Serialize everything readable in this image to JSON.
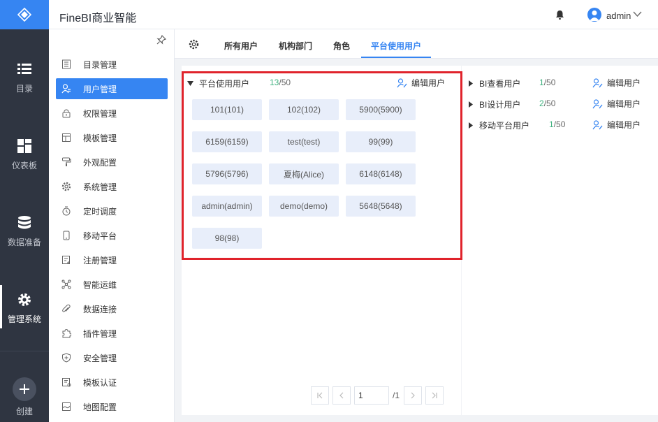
{
  "app": {
    "title": "FineBI商业智能",
    "user": "admin"
  },
  "rail": {
    "items": [
      {
        "label": "目录",
        "icon": "list-icon"
      },
      {
        "label": "仪表板",
        "icon": "dashboard-icon"
      },
      {
        "label": "数据准备",
        "icon": "database-icon"
      },
      {
        "label": "管理系统",
        "icon": "gear-icon"
      }
    ],
    "create_label": "创建"
  },
  "sidebar": {
    "items": [
      {
        "label": "目录管理",
        "icon": "catalog-icon"
      },
      {
        "label": "用户管理",
        "icon": "user-icon"
      },
      {
        "label": "权限管理",
        "icon": "lock-icon"
      },
      {
        "label": "模板管理",
        "icon": "template-icon"
      },
      {
        "label": "外观配置",
        "icon": "paint-roller-icon"
      },
      {
        "label": "系统管理",
        "icon": "settings-icon"
      },
      {
        "label": "定时调度",
        "icon": "timer-icon"
      },
      {
        "label": "移动平台",
        "icon": "mobile-icon"
      },
      {
        "label": "注册管理",
        "icon": "register-icon"
      },
      {
        "label": "智能运维",
        "icon": "network-icon"
      },
      {
        "label": "数据连接",
        "icon": "paperclip-icon"
      },
      {
        "label": "插件管理",
        "icon": "puzzle-icon"
      },
      {
        "label": "安全管理",
        "icon": "shield-icon"
      },
      {
        "label": "模板认证",
        "icon": "certificate-icon"
      },
      {
        "label": "地图配置",
        "icon": "map-icon"
      }
    ],
    "active_index": 1
  },
  "tabs": [
    {
      "label": "所有用户"
    },
    {
      "label": "机构部门"
    },
    {
      "label": "角色"
    },
    {
      "label": "平台使用用户"
    }
  ],
  "platform_group": {
    "name": "平台使用用户",
    "used": "13",
    "total": "/50",
    "edit_label": "编辑用户",
    "users": [
      "101(101)",
      "102(102)",
      "5900(5900)",
      "6159(6159)",
      "test(test)",
      "99(99)",
      "5796(5796)",
      "夏梅(Alice)",
      "6148(6148)",
      "admin(admin)",
      "demo(demo)",
      "5648(5648)",
      "98(98)"
    ]
  },
  "other_groups": [
    {
      "name": "BI查看用户",
      "used": "1",
      "total": "/50",
      "edit_label": "编辑用户"
    },
    {
      "name": "BI设计用户",
      "used": "2",
      "total": "/50",
      "edit_label": "编辑用户"
    },
    {
      "name": "移动平台用户",
      "used": "1",
      "total": "/50",
      "edit_label": "编辑用户"
    }
  ],
  "pager": {
    "page": "1",
    "total": "/1"
  },
  "colors": {
    "accent": "#3685f2",
    "count_green": "#3fb27f",
    "highlight_red": "#e0232b",
    "rail_bg": "#2f3541"
  }
}
